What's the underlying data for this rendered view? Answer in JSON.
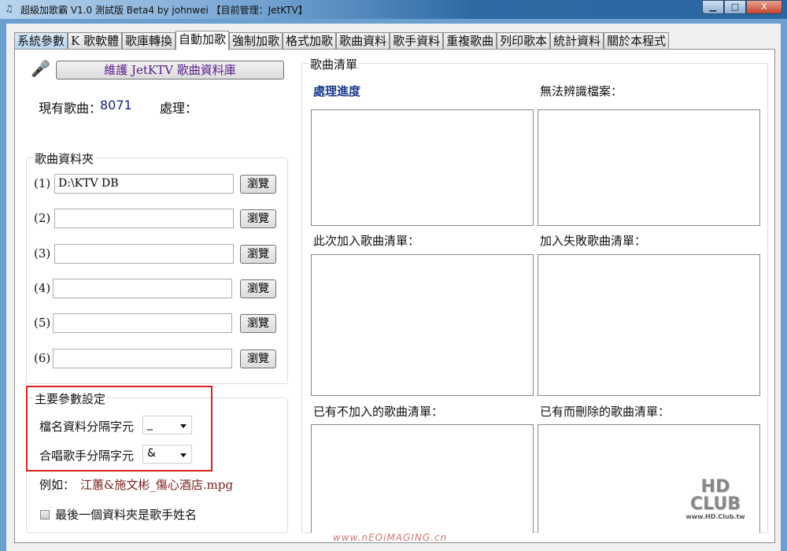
{
  "window": {
    "title": "超級加歌霸 V1.0 測試版 Beta4 by johnwei 【目前管理：JetKTV】",
    "minimize": "▁",
    "maximize": "□",
    "close": "X"
  },
  "tabs": [
    "系統參數",
    "K 歌軟體",
    "歌庫轉換",
    "自動加歌",
    "強制加歌",
    "格式加歌",
    "歌曲資料",
    "歌手資料",
    "重複歌曲",
    "列印歌本",
    "統計資料",
    "關於本程式"
  ],
  "active_tab": 3,
  "left": {
    "maintain_button": "維護 JetKTV 歌曲資料庫",
    "song_count_label": "現有歌曲：",
    "song_count": "8071",
    "process_label": "處理：",
    "folder_group": "歌曲資料夾",
    "folders": [
      {
        "label": "(1)",
        "value": "D:\\KTV DB"
      },
      {
        "label": "(2)",
        "value": ""
      },
      {
        "label": "(3)",
        "value": ""
      },
      {
        "label": "(4)",
        "value": ""
      },
      {
        "label": "(5)",
        "value": ""
      },
      {
        "label": "(6)",
        "value": ""
      }
    ],
    "browse": "瀏覽",
    "params_group": "主要參數設定",
    "filename_sep_label": "檔名資料分隔字元",
    "filename_sep": "_",
    "duet_sep_label": "合唱歌手分隔字元",
    "duet_sep": "&",
    "example_label": "例如：",
    "example_value": "江蕙&施文彬_傷心酒店.mpg",
    "last_folder_checkbox": "最後一個資料夾是歌手姓名"
  },
  "right": {
    "group": "歌曲清單",
    "progress": "處理進度",
    "unrecognized": "無法辨識檔案：",
    "added": "此次加入歌曲清單：",
    "failed": "加入失敗歌曲清單：",
    "skipped": "已有不加入的歌曲清單：",
    "deleted": "已有而刪除的歌曲清單："
  },
  "watermarks": {
    "site": "www.nEOiMAGING.cn",
    "logo": "HD CLUB",
    "logo_url": "www.HD.Club.tw"
  },
  "colors": {
    "highlight": "#e02020",
    "count": "#1a237e",
    "example": "#7a1f1f",
    "progress": "#1a3a8f"
  }
}
